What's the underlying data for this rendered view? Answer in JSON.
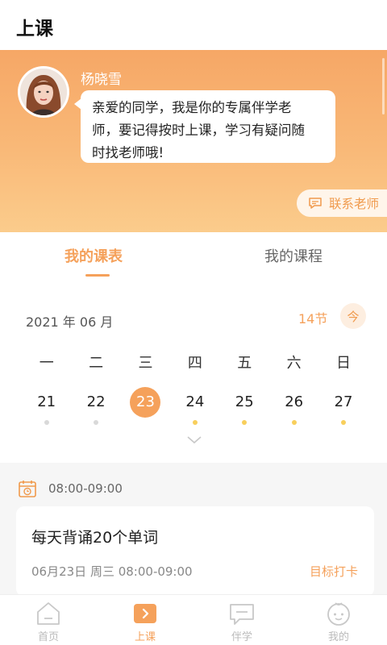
{
  "header": {
    "title": "上课"
  },
  "teacher": {
    "name": "杨晓雪",
    "message_lines": [
      "亲爱的同学，我是你的专属伴学老",
      "师，要记得按时上课，学习有疑问随",
      "时找老师哦!"
    ],
    "contact_label": "联系老师"
  },
  "tabs": [
    {
      "label": "我的课表",
      "active": true
    },
    {
      "label": "我的课程",
      "active": false
    }
  ],
  "calendar": {
    "month": "2021 年 06 月",
    "lesson_count": "14节",
    "today_label": "今",
    "weekdays": [
      "一",
      "二",
      "三",
      "四",
      "五",
      "六",
      "日"
    ],
    "dates": [
      {
        "num": "21",
        "dot": "gray"
      },
      {
        "num": "22",
        "dot": "gray"
      },
      {
        "num": "23",
        "dot": "none",
        "selected": true
      },
      {
        "num": "24",
        "dot": "yellow"
      },
      {
        "num": "25",
        "dot": "yellow"
      },
      {
        "num": "26",
        "dot": "yellow"
      },
      {
        "num": "27",
        "dot": "yellow"
      }
    ]
  },
  "schedule": {
    "time": "08:00-09:00",
    "card": {
      "title": "每天背诵20个单词",
      "meta": "06月23日   周三   08:00-09:00",
      "action": "目标打卡"
    }
  },
  "nav": [
    {
      "label": "首页",
      "icon": "home-icon",
      "active": false
    },
    {
      "label": "上课",
      "icon": "class-icon",
      "active": true
    },
    {
      "label": "伴学",
      "icon": "chat-icon",
      "active": false
    },
    {
      "label": "我的",
      "icon": "profile-icon",
      "active": false
    }
  ],
  "colors": {
    "accent": "#f5a15b",
    "banner_top": "#f6a766",
    "banner_bottom": "#fbcc8c"
  }
}
